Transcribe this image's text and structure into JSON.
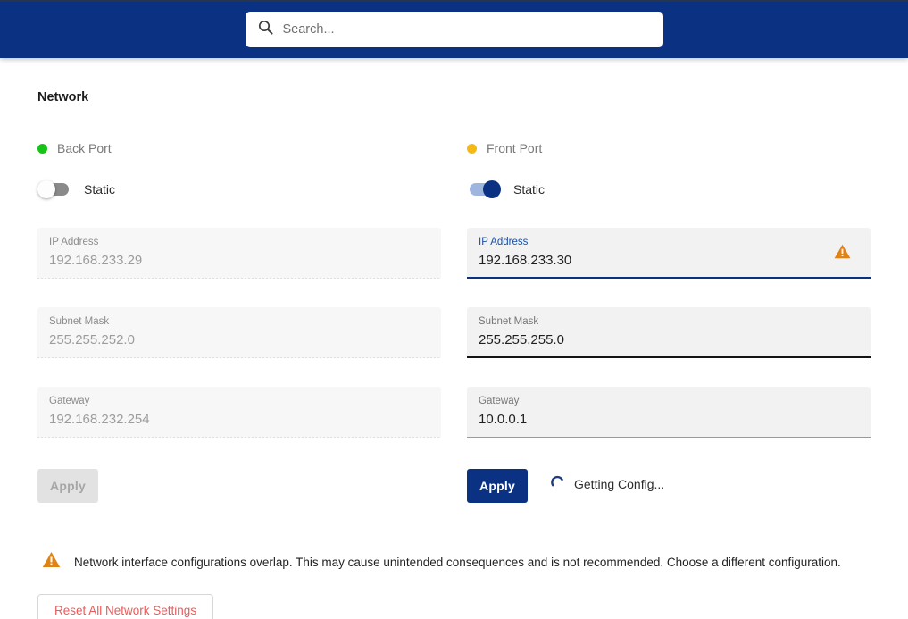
{
  "header": {
    "search": {
      "icon": "search-icon",
      "placeholder": "Search...",
      "value": ""
    }
  },
  "page": {
    "title": "Network"
  },
  "ports": [
    {
      "name": "Back Port",
      "status_color": "#18c318",
      "status_icon": "status-dot-green",
      "toggle": {
        "label": "Static",
        "on": false
      },
      "enabled": false,
      "fields": [
        {
          "label": "IP Address",
          "value": "192.168.233.29",
          "state": "disabled"
        },
        {
          "label": "Subnet Mask",
          "value": "255.255.252.0",
          "state": "disabled"
        },
        {
          "label": "Gateway",
          "value": "192.168.232.254",
          "state": "disabled"
        }
      ],
      "apply": {
        "label": "Apply",
        "enabled": false
      },
      "loading": {
        "visible": false,
        "text": ""
      }
    },
    {
      "name": "Front Port",
      "status_color": "#f5b916",
      "status_icon": "status-dot-amber",
      "toggle": {
        "label": "Static",
        "on": true
      },
      "enabled": true,
      "fields": [
        {
          "label": "IP Address",
          "value": "192.168.233.30",
          "state": "focused",
          "warning_icon": "warning-triangle-icon"
        },
        {
          "label": "Subnet Mask",
          "value": "255.255.255.0",
          "state": "strong"
        },
        {
          "label": "Gateway",
          "value": "10.0.0.1",
          "state": "weak"
        }
      ],
      "apply": {
        "label": "Apply",
        "enabled": true
      },
      "loading": {
        "visible": true,
        "text": "Getting Config...",
        "icon": "spinner-icon"
      }
    }
  ],
  "warning_banner": {
    "icon": "warning-triangle-icon",
    "text": "Network interface configurations overlap. This may cause unintended consequences and is not recommended. Choose a different configuration."
  },
  "reset_button": {
    "label": "Reset All Network Settings"
  },
  "colors": {
    "brand_blue": "#0b3183",
    "warning_orange": "#e08214",
    "danger_red": "#ea5b5b",
    "dot_green": "#18c318",
    "dot_amber": "#f5b916"
  }
}
